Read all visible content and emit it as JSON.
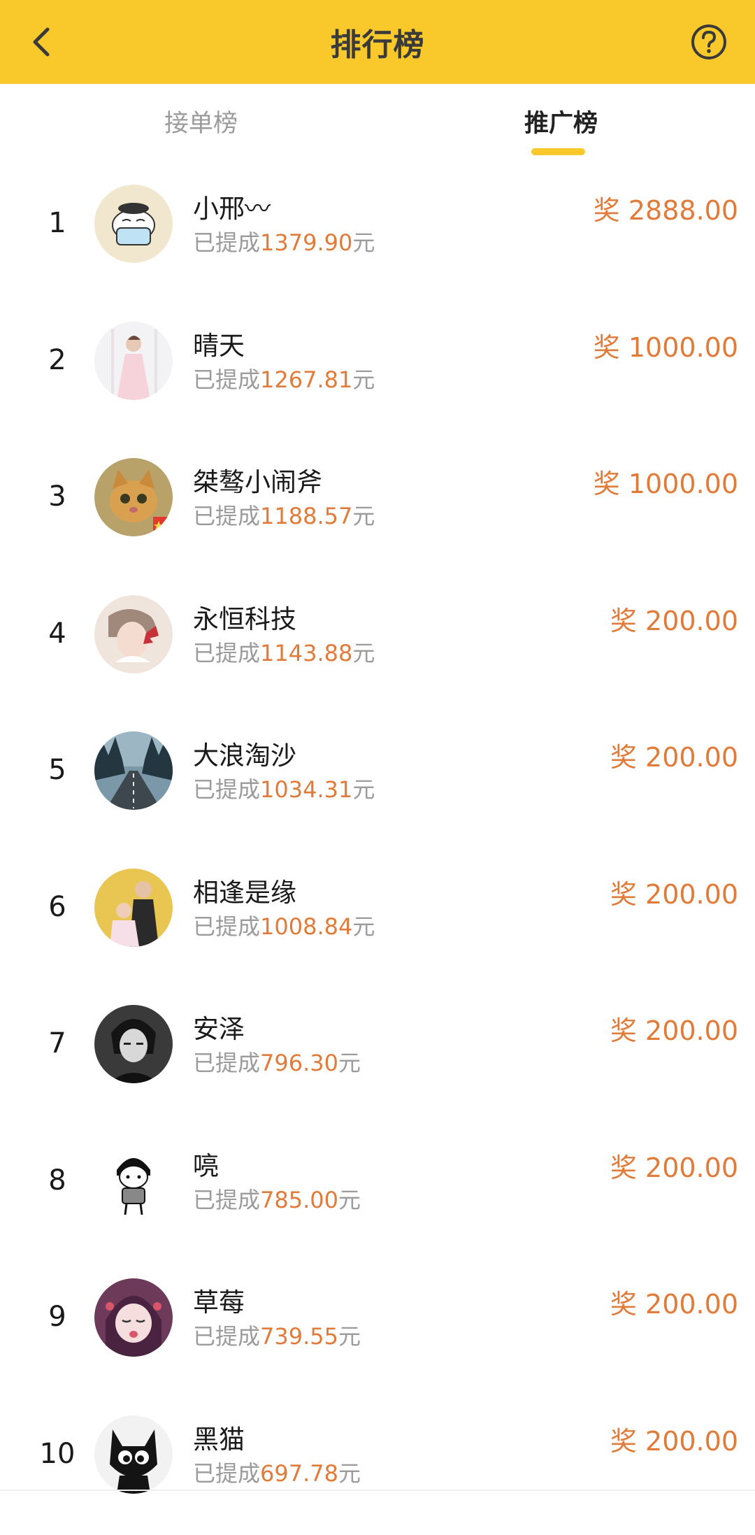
{
  "header": {
    "title": "排行榜"
  },
  "tabs": [
    {
      "label": "接单榜"
    },
    {
      "label": "推广榜"
    }
  ],
  "labels": {
    "withdrawn_prefix": "已提成",
    "currency_suffix": "元",
    "reward_prefix": "奖"
  },
  "colors": {
    "brand_yellow": "#f9c92b",
    "accent_orange": "#e07b39"
  },
  "ranking": [
    {
      "rank": "1",
      "name": "小邢〰",
      "withdrawn": "1379.90",
      "reward": "2888.00",
      "avatar": "cartoon-kid-avatar"
    },
    {
      "rank": "2",
      "name": "晴天",
      "withdrawn": "1267.81",
      "reward": "1000.00",
      "avatar": "girl-dress-avatar"
    },
    {
      "rank": "3",
      "name": "桀骜小闹斧",
      "withdrawn": "1188.57",
      "reward": "1000.00",
      "avatar": "kitten-avatar"
    },
    {
      "rank": "4",
      "name": "永恒科技",
      "withdrawn": "1143.88",
      "reward": "200.00",
      "avatar": "anime-butterfly-avatar"
    },
    {
      "rank": "5",
      "name": "大浪淘沙",
      "withdrawn": "1034.31",
      "reward": "200.00",
      "avatar": "forest-road-avatar"
    },
    {
      "rank": "6",
      "name": "相逢是缘",
      "withdrawn": "1008.84",
      "reward": "200.00",
      "avatar": "couple-avatar"
    },
    {
      "rank": "7",
      "name": "安泽",
      "withdrawn": "796.30",
      "reward": "200.00",
      "avatar": "monochrome-anime-avatar"
    },
    {
      "rank": "8",
      "name": "喨",
      "withdrawn": "785.00",
      "reward": "200.00",
      "avatar": "meme-kid-avatar"
    },
    {
      "rank": "9",
      "name": "草莓",
      "withdrawn": "739.55",
      "reward": "200.00",
      "avatar": "anime-girl-avatar"
    },
    {
      "rank": "10",
      "name": "黑猫",
      "withdrawn": "697.78",
      "reward": "200.00",
      "avatar": "black-cat-avatar"
    }
  ]
}
